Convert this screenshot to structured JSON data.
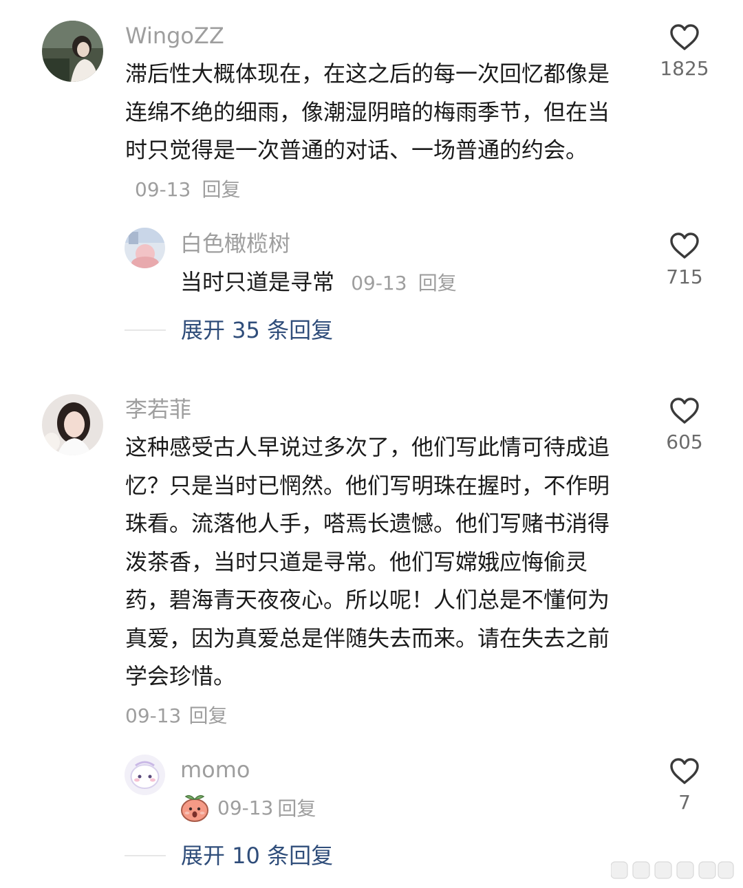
{
  "comments": [
    {
      "username": "WingoZZ",
      "text": "滞后性大概体现在，在这之后的每一次回忆都像是连绵不绝的细雨，像潮湿阴暗的梅雨季节，但在当时只觉得是一次普通的对话、一场普通的约会。",
      "date": "09-13",
      "reply_label": "回复",
      "likes": "1825",
      "reply": {
        "username": "白色橄榄树",
        "text": "当时只道是寻常",
        "date": "09-13",
        "reply_label": "回复",
        "likes": "715"
      },
      "expand_label": "展开 35 条回复"
    },
    {
      "username": "李若菲",
      "text": "这种感受古人早说过多次了，他们写此情可待成追忆？只是当时已惘然。他们写明珠在握时，不作明珠看。流落他人手，嗒焉长遗憾。他们写赌书消得泼茶香，当时只道是寻常。他们写嫦娥应悔偷灵药，碧海青天夜夜心。所以呢！人们总是不懂何为真爱，因为真爱总是伴随失去而来。请在失去之前学会珍惜。",
      "date": "09-13",
      "reply_label": "回复",
      "likes": "605",
      "reply": {
        "username": "momo",
        "text": "",
        "sticker": "peach-sticker-icon",
        "date": "09-13",
        "reply_label": "回复",
        "likes": "7"
      },
      "expand_label": "展开 10 条回复"
    }
  ],
  "colors": {
    "username": "#9e9e9e",
    "text": "#1a1a1a",
    "link": "#2f4d7a",
    "like_count": "#6b6b6b"
  },
  "icons": {
    "like": "heart-outline-icon"
  }
}
